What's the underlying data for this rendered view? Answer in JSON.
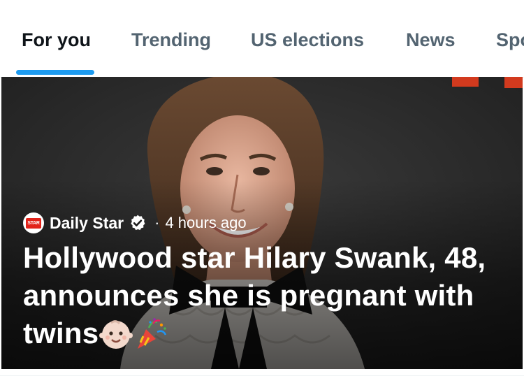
{
  "tabs": [
    {
      "label": "For you",
      "active": true
    },
    {
      "label": "Trending",
      "active": false
    },
    {
      "label": "US elections",
      "active": false
    },
    {
      "label": "News",
      "active": false
    },
    {
      "label": "Spo",
      "active": false
    }
  ],
  "colors": {
    "accent": "#1d9bf0",
    "active_text": "#0f1419",
    "inactive_text": "#536471",
    "source_red": "#e2231a"
  },
  "story": {
    "source_logo_text": "STAR",
    "source": "Daily Star",
    "verified_icon": "verified-badge-icon",
    "separator": "·",
    "time": "4 hours ago",
    "headline": "Hollywood star Hilary Swank, 48, announces she is pregnant with twins",
    "emojis": [
      "baby-face-emoji",
      "party-popper-emoji"
    ]
  }
}
